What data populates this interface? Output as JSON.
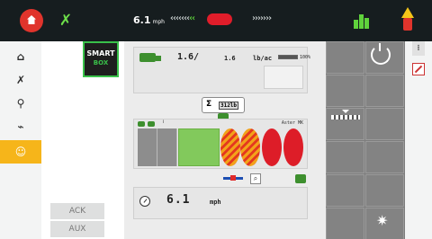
{
  "topbar": {
    "speed_value": "6.1",
    "speed_unit": "mph",
    "lightbar_left": "‹‹‹‹‹‹‹",
    "lightbar_left_active": "‹‹",
    "lightbar_right": "›››››››"
  },
  "sidenav": {
    "items": [
      {
        "icon": "home-icon",
        "glyph": "⌂"
      },
      {
        "icon": "gps-guidance-icon",
        "glyph": "✗"
      },
      {
        "icon": "implement-icon",
        "glyph": "⚲"
      },
      {
        "icon": "diagnostics-icon",
        "glyph": "⌁"
      },
      {
        "icon": "smart-app-icon",
        "glyph": "☺",
        "active": true
      }
    ]
  },
  "leftpanel": {
    "smartbox_line1": "SMART",
    "smartbox_line2": "BOX",
    "ack_label": "ACK",
    "aux_label": "AUX"
  },
  "rate_card": {
    "actual": "1.6/",
    "target": "1.6",
    "unit": "lb/ac",
    "percent": "100%",
    "bar_fraction": 1.0
  },
  "sigma": {
    "symbol": "Σ",
    "value": "312lb"
  },
  "boom": {
    "marker": "i",
    "label": "Aster MK",
    "sections": [
      "gray",
      "gray",
      "green",
      "hatched",
      "hatched",
      "red",
      "red"
    ]
  },
  "controls": {
    "zoom_glyph": "⌕"
  },
  "speed_card": {
    "value": "6.1",
    "unit": "mph"
  },
  "softkeys": {
    "gear_glyph": "✷"
  },
  "rightstrip": {
    "menu_glyph": "⁝"
  },
  "colors": {
    "topbar": "#161d1f",
    "home_red": "#e0342c",
    "gps_green": "#6ee04a",
    "section_green": "#82c95c",
    "section_red": "#dd1d28",
    "section_gray": "#8d8d8d",
    "nav_active": "#f6b51a",
    "smartbox_border": "#3ac14a"
  }
}
